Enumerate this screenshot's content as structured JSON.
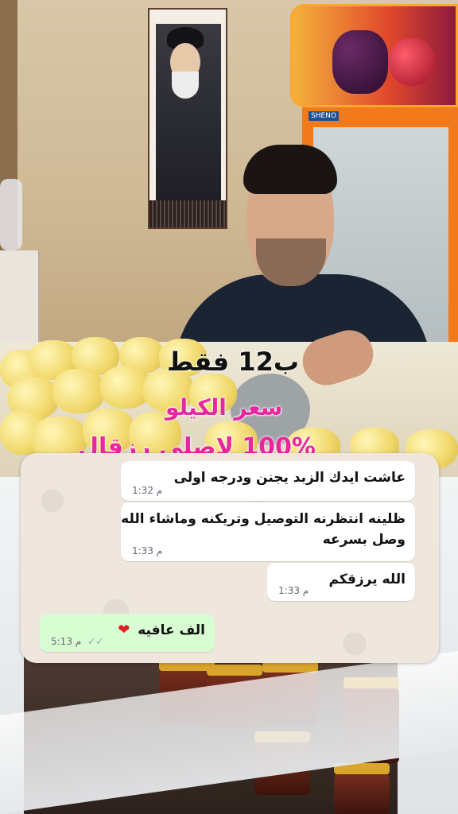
{
  "overlay": {
    "price": "ب12 فقط",
    "kilo_price": "سعر الكيلو",
    "pure": "100% لاصلي رزقال"
  },
  "chat": {
    "messages": [
      {
        "text": "عاشت ايدك الزبد يجنن ودرجه اولى",
        "time": "1:32 م",
        "direction": "incoming"
      },
      {
        "text": "ظلينه انتظرنه التوصيل وتريكنه وماشاء الله",
        "text2": "وصل بسرعه",
        "time": "1:33 م",
        "direction": "incoming"
      },
      {
        "text": "الله يرزقكم",
        "time": "1:33 م",
        "direction": "incoming"
      },
      {
        "text": "الف عافيه",
        "time": "5:13 م",
        "direction": "outgoing",
        "emoji": "❤"
      }
    ]
  },
  "fridge_brand": "SHENO",
  "colors": {
    "accent_pink": "#e8279e",
    "outgoing_bubble": "#d9fdd3",
    "incoming_bubble": "#ffffff"
  }
}
